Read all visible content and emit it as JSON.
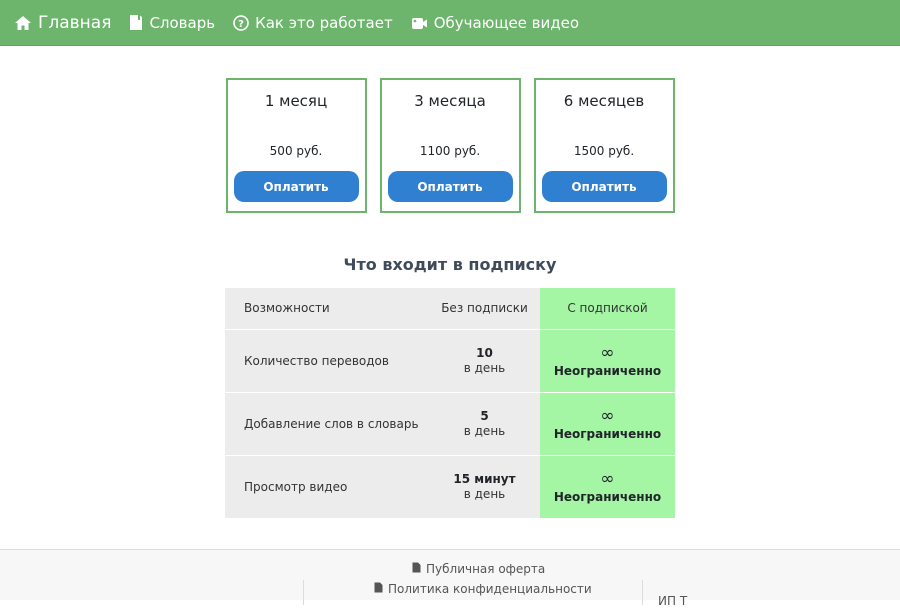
{
  "nav": {
    "home": "Главная",
    "dictionary": "Словарь",
    "how_it_works": "Как это работает",
    "tutorial_video": "Обучающее видео",
    "icons": [
      "home-icon",
      "book-icon",
      "question-icon",
      "video-camera-icon"
    ]
  },
  "plans": [
    {
      "title": "1 месяц",
      "price": "500 руб.",
      "button": "Оплатить"
    },
    {
      "title": "3 месяца",
      "price": "1100 руб.",
      "button": "Оплатить"
    },
    {
      "title": "6 месяцев",
      "price": "1500 руб.",
      "button": "Оплатить"
    }
  ],
  "section_title": "Что входит в подписку",
  "table": {
    "headers": [
      "Возможности",
      "Без подписки",
      "С подпиской"
    ],
    "rows": [
      {
        "feature": "Количество переводов",
        "free_value": "10",
        "free_unit": "в день",
        "sub_symbol": "∞",
        "sub_label": "Неограниченно"
      },
      {
        "feature": "Добавление слов в словарь",
        "free_value": "5",
        "free_unit": "в день",
        "sub_symbol": "∞",
        "sub_label": "Неограниченно"
      },
      {
        "feature": "Просмотр видео",
        "free_value": "15 минут",
        "free_unit": "в день",
        "sub_symbol": "∞",
        "sub_label": "Неограниченно"
      }
    ]
  },
  "footer": {
    "public_offer": "Публичная оферта",
    "privacy_policy": "Политика конфиденциальности",
    "right_text": "ИП Т"
  },
  "colors": {
    "navbar": "#6db56d",
    "plan_border": "#6db56d",
    "button": "#2f80d1",
    "subscription_column": "#a4f5a4",
    "table_gray": "#ececec"
  }
}
